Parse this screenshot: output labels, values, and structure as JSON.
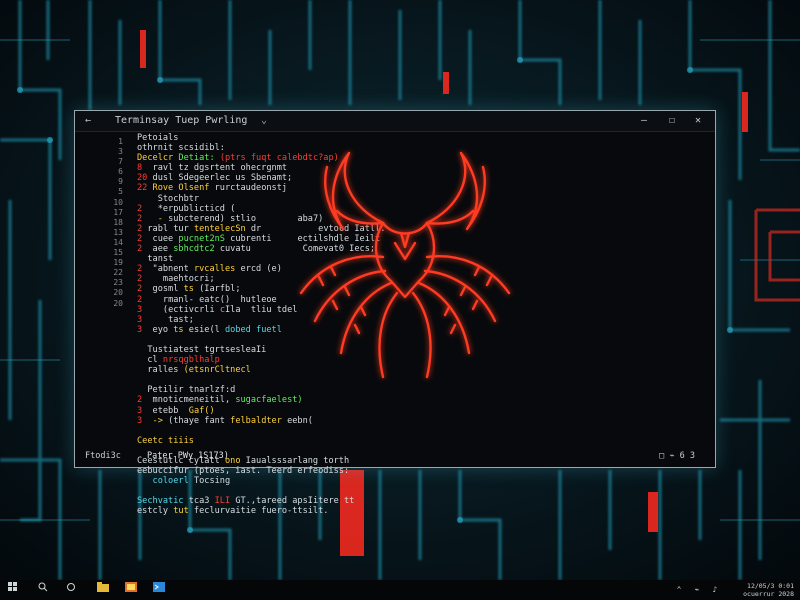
{
  "window": {
    "title": "Terminsay Tuep Pwrling",
    "back_glyph": "←",
    "dropdown_glyph": "⌄",
    "minimize_glyph": "—",
    "maximize_glyph": "☐",
    "close_glyph": "✕"
  },
  "line_numbers": [
    "1",
    "3",
    "7",
    "6",
    "9",
    "5",
    "10",
    "17",
    "18",
    "13",
    "14",
    "15",
    "19",
    "22",
    "23",
    "20",
    "20"
  ],
  "code_lines": [
    [
      {
        "t": "Petoials",
        "c": "c-w"
      }
    ],
    [
      {
        "t": "othrnit scsidibl:",
        "c": "c-w"
      }
    ],
    [
      {
        "t": "Decelcr ",
        "c": "c-y"
      },
      {
        "t": "Detiat: ",
        "c": "c-g"
      },
      {
        "t": "(ptrs fuqt calebdtc?ap)",
        "c": "c-r"
      }
    ],
    [
      {
        "t": "8  ",
        "c": "c-r"
      },
      {
        "t": "ravl tz dgsrtent ohecrgnmt",
        "c": "c-w"
      }
    ],
    [
      {
        "t": "20 ",
        "c": "c-r"
      },
      {
        "t": "dusl Sdegeerlec us Sbenamt;",
        "c": "c-w"
      }
    ],
    [
      {
        "t": "22 ",
        "c": "c-r"
      },
      {
        "t": "Rove Olsenf ",
        "c": "c-y"
      },
      {
        "t": "rurctaudeonstj",
        "c": "c-w"
      }
    ],
    [
      {
        "t": "    ",
        "c": "c-w"
      },
      {
        "t": "Stochbtr",
        "c": "c-w"
      }
    ],
    [
      {
        "t": "2   ",
        "c": "c-r"
      },
      {
        "t": "*erpublicticd (",
        "c": "c-w"
      }
    ],
    [
      {
        "t": "2   ",
        "c": "c-r"
      },
      {
        "t": "- ",
        "c": "c-y"
      },
      {
        "t": "subcterend) stlio",
        "c": "c-w"
      },
      {
        "t": "        ",
        "c": "c-w"
      },
      {
        "t": "aba7)",
        "c": "c-w"
      }
    ],
    [
      {
        "t": "2 ",
        "c": "c-r"
      },
      {
        "t": "rabl tur ",
        "c": "c-w"
      },
      {
        "t": "tentelecSn ",
        "c": "c-y"
      },
      {
        "t": "dr",
        "c": "c-w"
      },
      {
        "t": "           ",
        "c": "c-w"
      },
      {
        "t": "evtocd Iatll.",
        "c": "c-w"
      }
    ],
    [
      {
        "t": "2  ",
        "c": "c-r"
      },
      {
        "t": "cuee ",
        "c": "c-w"
      },
      {
        "t": "pucnet2nS ",
        "c": "c-g"
      },
      {
        "t": "cubrenti",
        "c": "c-w"
      },
      {
        "t": "     ",
        "c": "c-w"
      },
      {
        "t": "ectilshdle Ieilt",
        "c": "c-w"
      }
    ],
    [
      {
        "t": "2  ",
        "c": "c-r"
      },
      {
        "t": "aee ",
        "c": "c-w"
      },
      {
        "t": "sbhcdtc2 ",
        "c": "c-g"
      },
      {
        "t": "cuvatu",
        "c": "c-w"
      },
      {
        "t": "          ",
        "c": "c-w"
      },
      {
        "t": "Comevat0 Iecs;",
        "c": "c-w"
      }
    ],
    [
      {
        "t": "  ",
        "c": "c-w"
      },
      {
        "t": "tanst",
        "c": "c-w"
      }
    ],
    [
      {
        "t": "2  ",
        "c": "c-r"
      },
      {
        "t": "\"abnent ",
        "c": "c-w"
      },
      {
        "t": "rvcalles ",
        "c": "c-y"
      },
      {
        "t": "ercd (e)",
        "c": "c-w"
      }
    ],
    [
      {
        "t": "2  ",
        "c": "c-r"
      },
      {
        "t": "  ",
        "c": "c-w"
      },
      {
        "t": "maehtocri;",
        "c": "c-w"
      }
    ],
    [
      {
        "t": "2  ",
        "c": "c-r"
      },
      {
        "t": "gosml ",
        "c": "c-w"
      },
      {
        "t": "ts ",
        "c": "c-y"
      },
      {
        "t": "(Iarfbl;",
        "c": "c-w"
      }
    ],
    [
      {
        "t": "2  ",
        "c": "c-r"
      },
      {
        "t": "  ",
        "c": "c-w"
      },
      {
        "t": "rmanl- eatc()  ",
        "c": "c-w"
      },
      {
        "t": "hutleoe",
        "c": "c-w"
      }
    ],
    [
      {
        "t": "3  ",
        "c": "c-r"
      },
      {
        "t": "  ",
        "c": "c-w"
      },
      {
        "t": "(ectivcrli ",
        "c": "c-w"
      },
      {
        "t": "c",
        "c": "c-o"
      },
      {
        "t": "Ila  ",
        "c": "c-w"
      },
      {
        "t": "tliu tdel",
        "c": "c-w"
      }
    ],
    [
      {
        "t": "3  ",
        "c": "c-r"
      },
      {
        "t": "   ",
        "c": "c-w"
      },
      {
        "t": "tast;",
        "c": "c-w"
      }
    ],
    [
      {
        "t": "3  ",
        "c": "c-r"
      },
      {
        "t": "eyo ",
        "c": "c-w"
      },
      {
        "t": "ts ",
        "c": "c-y"
      },
      {
        "t": "esie(l ",
        "c": "c-w"
      },
      {
        "t": "dobed fuetl",
        "c": "c-c"
      }
    ],
    [
      {
        "t": "",
        "c": "c-w"
      }
    ],
    [
      {
        "t": "  ",
        "c": "c-w"
      },
      {
        "t": "Tustiatest tgrtsesleaIi",
        "c": "c-w"
      }
    ],
    [
      {
        "t": "  ",
        "c": "c-w"
      },
      {
        "t": "cl ",
        "c": "c-w"
      },
      {
        "t": "nrsqgblhalp",
        "c": "c-r"
      }
    ],
    [
      {
        "t": "  ",
        "c": "c-w"
      },
      {
        "t": "ralles ",
        "c": "c-w"
      },
      {
        "t": "(etsnrCltnecl",
        "c": "c-y"
      }
    ],
    [
      {
        "t": "",
        "c": "c-w"
      }
    ],
    [
      {
        "t": "  ",
        "c": "c-w"
      },
      {
        "t": "Petilir ",
        "c": "c-w"
      },
      {
        "t": "tnarlzf:d",
        "c": "c-w"
      }
    ],
    [
      {
        "t": "2  ",
        "c": "c-r"
      },
      {
        "t": "mnoticmeneitil, ",
        "c": "c-w"
      },
      {
        "t": "sugacfaelest)",
        "c": "c-g"
      }
    ],
    [
      {
        "t": "3  ",
        "c": "c-r"
      },
      {
        "t": "etebb",
        "c": "c-w"
      },
      {
        "t": "  ",
        "c": "c-w"
      },
      {
        "t": "Gaf()",
        "c": "c-y"
      }
    ],
    [
      {
        "t": "3  ",
        "c": "c-r"
      },
      {
        "t": "-> ",
        "c": "c-y"
      },
      {
        "t": "(thaye fant ",
        "c": "c-w"
      },
      {
        "t": "felbaldter ",
        "c": "c-y"
      },
      {
        "t": "eebn(",
        "c": "c-w"
      }
    ],
    [
      {
        "t": "",
        "c": "c-w"
      }
    ],
    [
      {
        "t": "Ceetc tiiis",
        "c": "c-y"
      }
    ],
    [
      {
        "t": "",
        "c": "c-w"
      }
    ],
    [
      {
        "t": "Ceestutlc cylatt",
        "c": "c-w"
      },
      {
        "t": " ono ",
        "c": "c-y"
      },
      {
        "t": "Iaualsssarlang torth",
        "c": "c-w"
      }
    ],
    [
      {
        "t": "eebuccifur (ptoes, iast. Teerd erfeodiss:",
        "c": "c-w"
      }
    ],
    [
      {
        "t": "   ",
        "c": "c-w"
      },
      {
        "t": "coloerl ",
        "c": "c-c"
      },
      {
        "t": "Tocsing",
        "c": "c-w"
      }
    ],
    [
      {
        "t": "",
        "c": "c-w"
      }
    ],
    [
      {
        "t": "Sechvatic ",
        "c": "c-c"
      },
      {
        "t": "tca3 ",
        "c": "c-w"
      },
      {
        "t": "ILI ",
        "c": "c-r"
      },
      {
        "t": "GT.,",
        "c": "c-w"
      },
      {
        "t": "tareed apsIitere tt",
        "c": "c-w"
      }
    ],
    [
      {
        "t": "estcly ",
        "c": "c-w"
      },
      {
        "t": "tut ",
        "c": "c-y"
      },
      {
        "t": "feclurvaitie ",
        "c": "c-w"
      },
      {
        "t": "fuero-ttsilt.",
        "c": "c-w"
      }
    ]
  ],
  "status": {
    "left": "Ftodi3c",
    "message": "Pater PWy 1S173)",
    "right": "□ ⌁ 6 3"
  },
  "taskbar": {
    "clock_line1": "12/05/3 0:01",
    "clock_line2": "ocuerrur 2028"
  }
}
